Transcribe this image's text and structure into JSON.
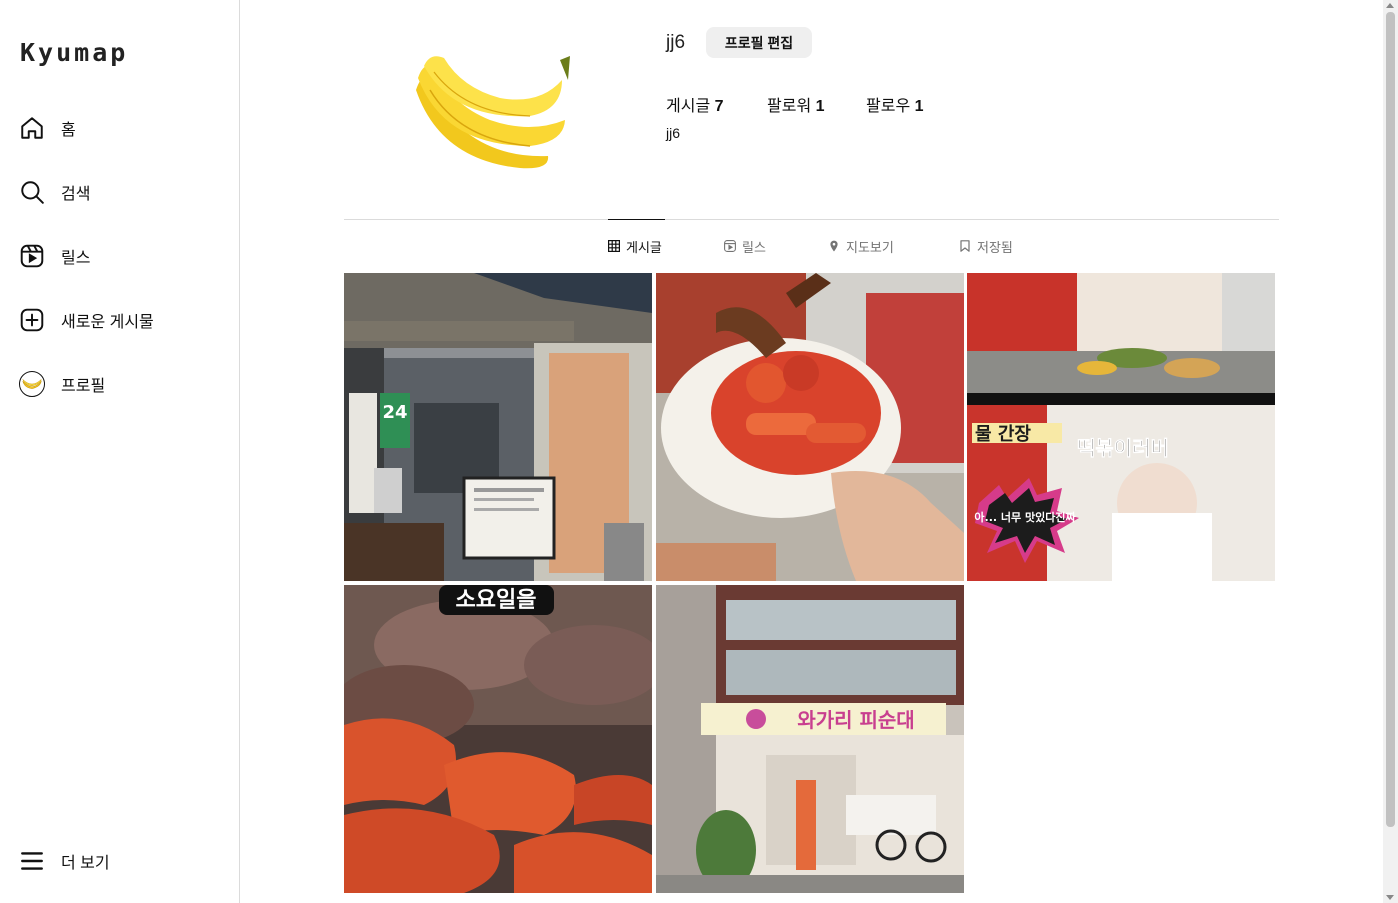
{
  "sidebar": {
    "logo": "Kyumap",
    "items": [
      {
        "label": "홈",
        "icon": "home-icon"
      },
      {
        "label": "검색",
        "icon": "search-icon"
      },
      {
        "label": "릴스",
        "icon": "reels-icon"
      },
      {
        "label": "새로운 게시물",
        "icon": "plus-square-icon"
      },
      {
        "label": "프로필",
        "icon": "banana-avatar-icon"
      }
    ],
    "more_label": "더 보기"
  },
  "profile": {
    "username": "jj6",
    "edit_button": "프로필 편집",
    "stats": [
      {
        "label": "게시글",
        "value": "7"
      },
      {
        "label": "팔로워",
        "value": "1"
      },
      {
        "label": "팔로우",
        "value": "1"
      }
    ],
    "bio": "jj6"
  },
  "tabs": [
    {
      "label": "게시글",
      "icon": "grid-icon",
      "active": true
    },
    {
      "label": "릴스",
      "icon": "reels-icon",
      "active": false
    },
    {
      "label": "지도보기",
      "icon": "map-pin-icon",
      "active": false
    },
    {
      "label": "저장됨",
      "icon": "bookmark-icon",
      "active": false
    }
  ],
  "posts": {
    "p4_caption": "떡볶이러버",
    "p4_sign": "물 간장",
    "p4_burst": "아... 너무 맛있다진짜",
    "p5_caption": "소요일을",
    "p6_sign": "와가리 피순대",
    "p1_sign": "24"
  },
  "colors": {
    "active_text": "#111111",
    "inactive_tab": "#737373",
    "border": "#dbdbdb",
    "button_bg": "#efefef"
  }
}
